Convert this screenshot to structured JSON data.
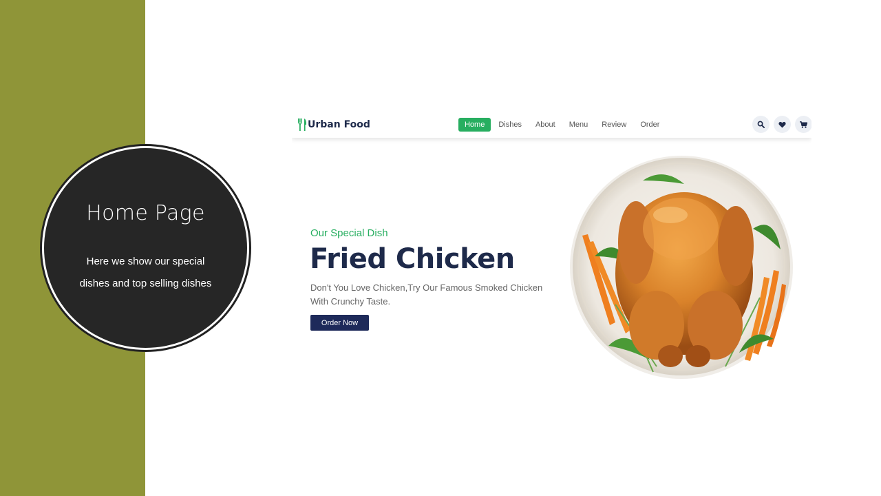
{
  "slide": {
    "title": "Home Page",
    "description_line1": "Here we show our special",
    "description_line2": "dishes and top selling dishes",
    "accent_color": "#8f9538"
  },
  "site": {
    "brand": "Urban Food",
    "nav": [
      "Home",
      "Dishes",
      "About",
      "Menu",
      "Review",
      "Order"
    ],
    "active_nav": "Home",
    "header_icons": [
      "search-icon",
      "heart-icon",
      "cart-icon"
    ],
    "hero": {
      "eyebrow": "Our Special Dish",
      "title": "Fried Chicken",
      "subtitle_line1": "Don't You Love Chicken,Try Our Famous Smoked Chicken",
      "subtitle_line2": "With Crunchy Taste.",
      "cta_label": "Order Now"
    },
    "colors": {
      "primary": "#27ae60",
      "navy": "#1e2a4a"
    }
  }
}
